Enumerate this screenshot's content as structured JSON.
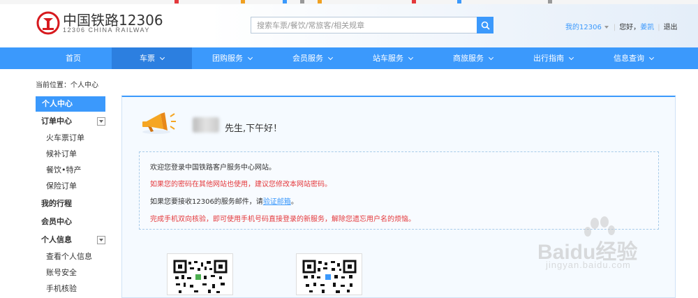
{
  "browser_strip": {
    "colors": [
      "#e4393c",
      "#f0a020",
      "#3b99fc",
      "#999999",
      "#f0a020",
      "#e4393c",
      "#3b99fc",
      "#999999"
    ]
  },
  "header": {
    "logo_icon": "china-railway-logo-icon",
    "logo_cn": "中国铁路12306",
    "logo_en": "12306 CHINA RAILWAY",
    "search": {
      "placeholder": "搜索车票/餐饮/常旅客/相关规章",
      "button_icon": "search-icon"
    },
    "user": {
      "my_12306": "我的12306",
      "greeting_prefix": "您好，",
      "username": "姜凯",
      "logout": "退出"
    }
  },
  "nav": {
    "items": [
      {
        "label": "首页",
        "has_caret": false
      },
      {
        "label": "车票",
        "has_caret": true,
        "active": true
      },
      {
        "label": "团购服务",
        "has_caret": true
      },
      {
        "label": "会员服务",
        "has_caret": true
      },
      {
        "label": "站车服务",
        "has_caret": true
      },
      {
        "label": "商旅服务",
        "has_caret": true
      },
      {
        "label": "出行指南",
        "has_caret": true
      },
      {
        "label": "信息查询",
        "has_caret": true
      }
    ]
  },
  "breadcrumb": "当前位置：个人中心",
  "sidebar": {
    "active": "个人中心",
    "sections": [
      {
        "title": "订单中心",
        "collapsible": true,
        "items": [
          "火车票订单",
          "候补订单",
          "餐饮•特产",
          "保险订单"
        ]
      },
      {
        "title": "我的行程",
        "collapsible": false,
        "items": []
      },
      {
        "title": "会员中心",
        "collapsible": false,
        "items": []
      },
      {
        "title": "个人信息",
        "collapsible": true,
        "items": [
          "查看个人信息",
          "账号安全",
          "手机核验"
        ]
      }
    ]
  },
  "main": {
    "megaphone_icon": "megaphone-icon",
    "greeting": "先生,下午好！",
    "notice": {
      "line1": "欢迎您登录中国铁路客户服务中心网站。",
      "line2": "如果您的密码在其他网站也使用，建议您修改本网站密码。",
      "line3_prefix": "如果您要接收12306的服务邮件，请",
      "line3_link": "验证邮箱",
      "line3_suffix": "。",
      "line4": "完成手机双向核验，即可使用手机号码直接登录的新服务，解除您遗忘用户名的烦恼。"
    },
    "qr_codes": [
      "qr-code-icon",
      "qr-code-icon"
    ]
  },
  "watermark": {
    "brand": "Baidu经验",
    "url": "jingyan.baidu.com"
  },
  "colors": {
    "nav_blue": "#3b99fc",
    "nav_active": "#2c7fe0",
    "warning_red": "#e4393c",
    "logo_red": "#d7191e"
  }
}
